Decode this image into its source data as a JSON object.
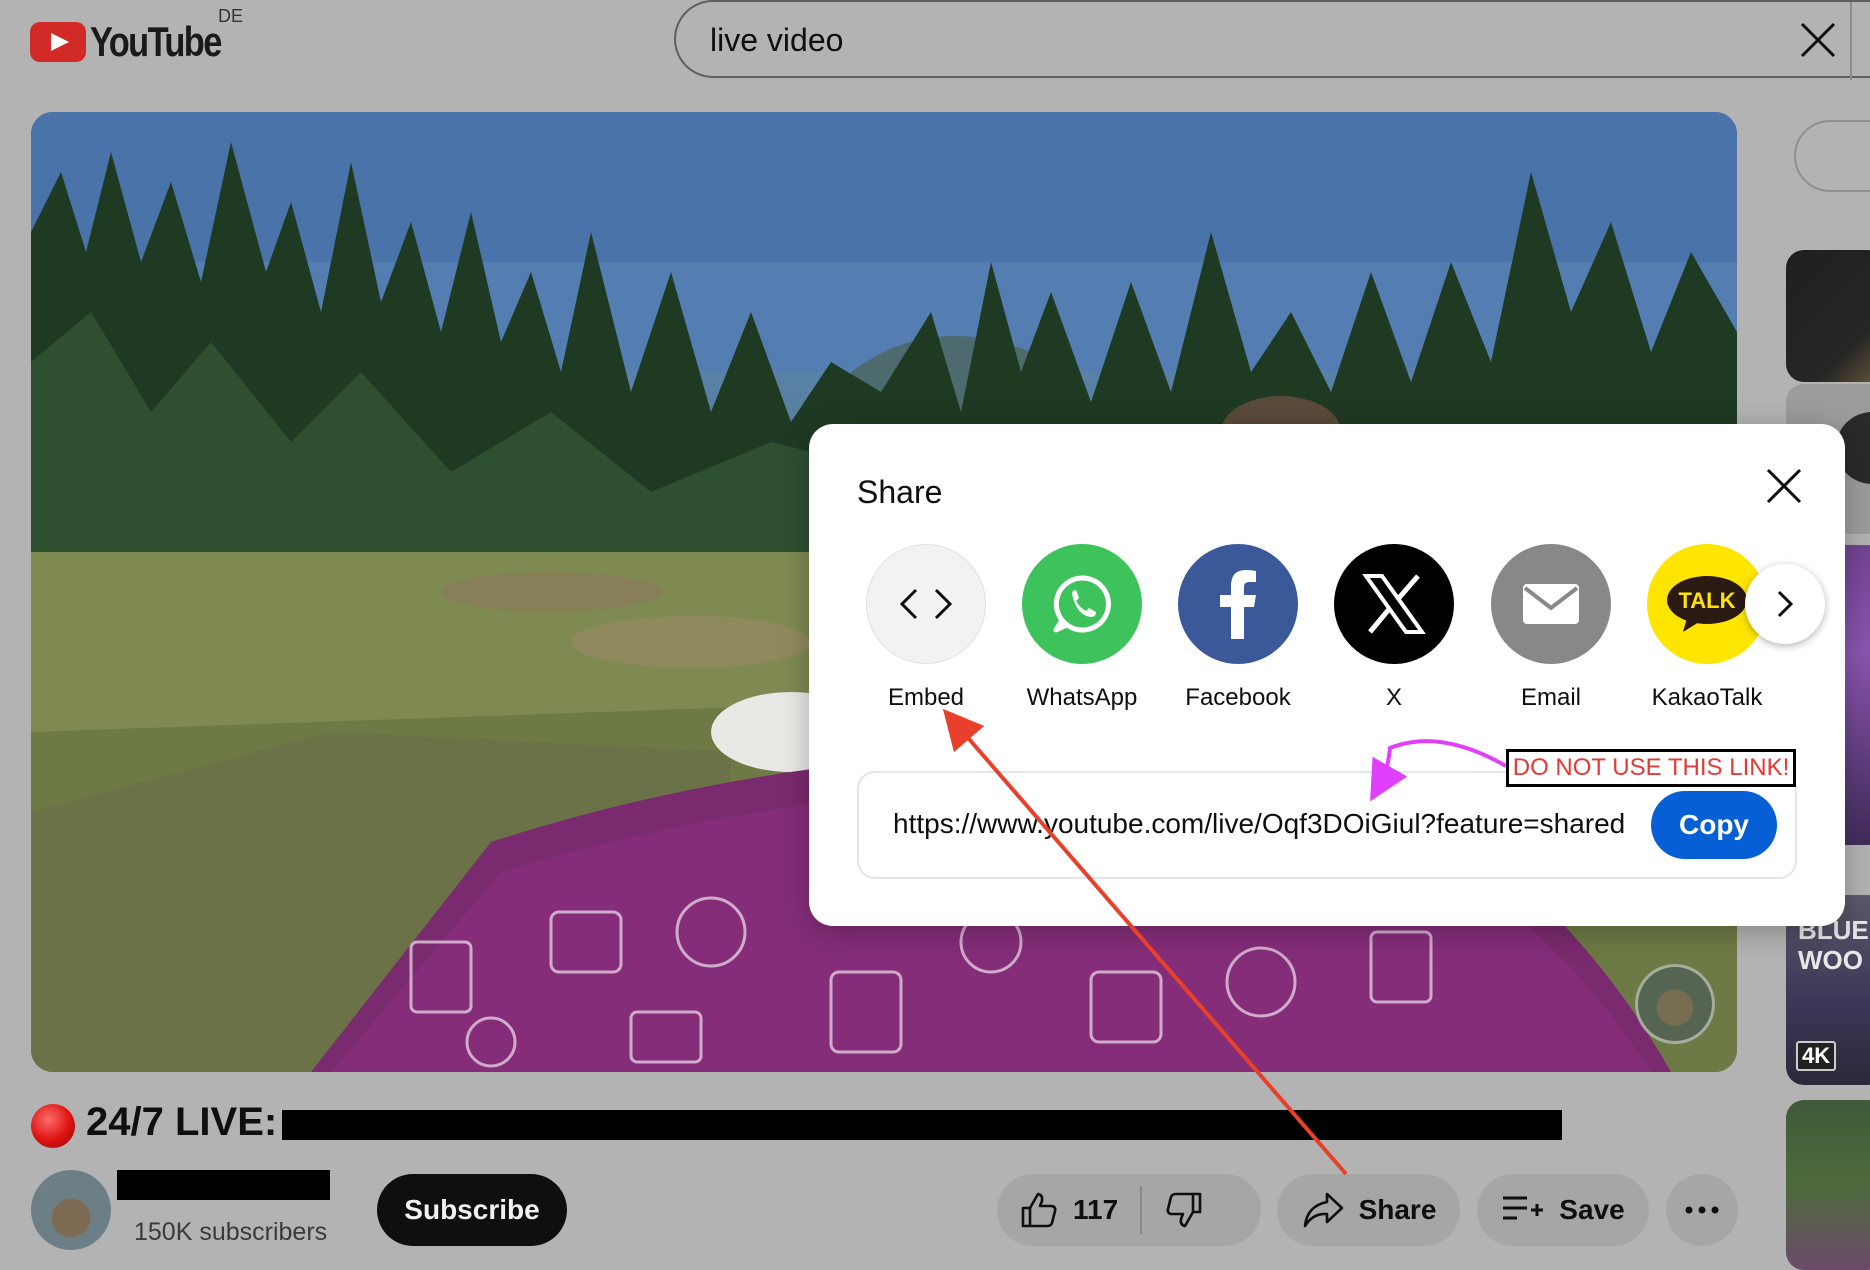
{
  "header": {
    "logo_text": "YouTube",
    "region": "DE",
    "search_value": "live video"
  },
  "video": {
    "title_visible": "24/7 LIVE:",
    "channel_subscribers": "150K subscribers",
    "subscribe_label": "Subscribe",
    "like_count": "117",
    "share_label": "Share",
    "save_label": "Save"
  },
  "share_dialog": {
    "title": "Share",
    "options": [
      {
        "label": "Embed"
      },
      {
        "label": "WhatsApp"
      },
      {
        "label": "Facebook"
      },
      {
        "label": "X"
      },
      {
        "label": "Email"
      },
      {
        "label": "KakaoTalk"
      }
    ],
    "kakao_badge": "TALK",
    "url": "https://www.youtube.com/live/Oqf3DOiGiul?feature=shared",
    "copy_label": "Copy"
  },
  "annotation": {
    "warning": "DO NOT USE THIS LINK!"
  },
  "right_rail": {
    "thumb_text_line1": "BLUEE",
    "thumb_text_line2": "WOO",
    "badge": "4K"
  },
  "colors": {
    "accent": "#065fd4",
    "overlay": "#b3b3b3",
    "arrow_red": "#e8402a",
    "arrow_magenta": "#e040fb",
    "warning_text": "#e53935"
  }
}
